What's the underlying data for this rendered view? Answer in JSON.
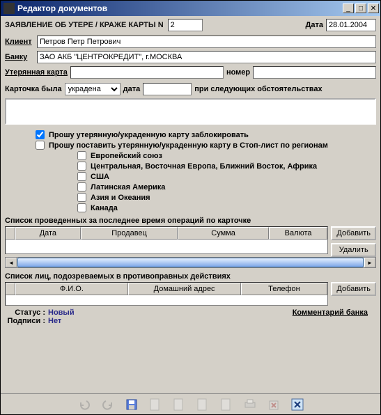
{
  "window": {
    "title": "Редактор документов"
  },
  "header": {
    "form_title": "ЗАЯВЛЕНИЕ ОБ УТЕРЕ / КРАЖЕ КАРТЫ N",
    "card_n": "2",
    "date_label": "Дата",
    "date_value": "28.01.2004"
  },
  "fields": {
    "client_label": "Клиент",
    "client_value": "Петров Петр Петрович",
    "bank_label": "Банку",
    "bank_value": "ЗАО АКБ \"ЦЕНТРОКРЕДИТ\", г.МОСКВА",
    "lostcard_label": "Утерянная карта",
    "lostcard_value": "",
    "number_label": "номер",
    "number_value": "",
    "card_was_label": "Карточка была",
    "card_was_value": "украдена",
    "circ_date_label": "дата",
    "circ_date_value": "",
    "circ_tail": "при следующих обстоятельствах"
  },
  "checkboxes": {
    "block_label": "Прошу утерянную/украденную карту заблокировать",
    "block_checked": true,
    "stoplist_label": "Прошу поставить утерянную/украденную карту в Стоп-лист по регионам",
    "stoplist_checked": false,
    "regions": [
      "Европейский союз",
      "Центральная, Восточная Европа, Ближний Восток, Африка",
      "США",
      "Латинская Америка",
      "Азия и Океания",
      "Канада"
    ]
  },
  "ops": {
    "title": "Список проведенных за последнее время операций по карточке",
    "cols": [
      "Дата",
      "Продавец",
      "Сумма",
      "Валюта"
    ],
    "add": "Добавить",
    "del": "Удалить"
  },
  "suspects": {
    "title": "Список лиц, подозреваемых в противоправных действиях",
    "cols": [
      "Ф.И.О.",
      "Домашний адрес",
      "Телефон"
    ],
    "add": "Добавить"
  },
  "status": {
    "status_label": "Статус :",
    "status_value": "Новый",
    "sign_label": "Подписи :",
    "sign_value": "Нет",
    "comment_link": "Комментарий банка"
  }
}
